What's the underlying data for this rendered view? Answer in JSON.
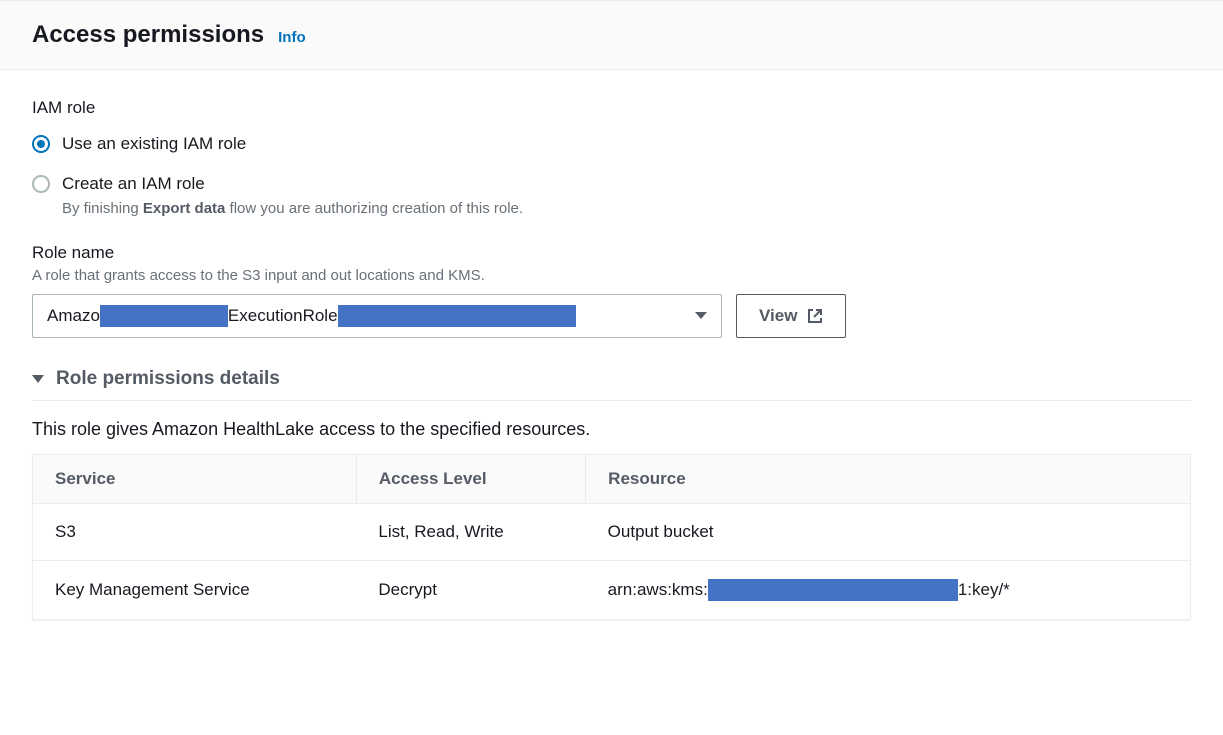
{
  "header": {
    "title": "Access permissions",
    "info": "Info"
  },
  "iamRole": {
    "label": "IAM role",
    "options": {
      "existing": {
        "label": "Use an existing IAM role",
        "selected": true
      },
      "create": {
        "label": "Create an IAM role",
        "desc_prefix": "By finishing ",
        "desc_bold": "Export data",
        "desc_suffix": " flow you are authorizing creation of this role.",
        "selected": false
      }
    }
  },
  "roleName": {
    "label": "Role name",
    "hint": "A role that grants access to the S3 input and out locations and KMS.",
    "value_prefix": "Amazo",
    "value_middle": "ExecutionRole",
    "viewLabel": "View"
  },
  "permissions": {
    "expandTitle": "Role permissions details",
    "description": "This role gives Amazon HealthLake access to the specified resources.",
    "columns": {
      "service": "Service",
      "accessLevel": "Access Level",
      "resource": "Resource"
    },
    "rows": [
      {
        "service": "S3",
        "accessLevel": "List, Read, Write",
        "resource": "Output bucket",
        "hasRedactedArn": false
      },
      {
        "service": "Key Management Service",
        "accessLevel": "Decrypt",
        "resource_prefix": "arn:aws:kms:",
        "resource_suffix": "1:key/*",
        "hasRedactedArn": true
      }
    ]
  }
}
